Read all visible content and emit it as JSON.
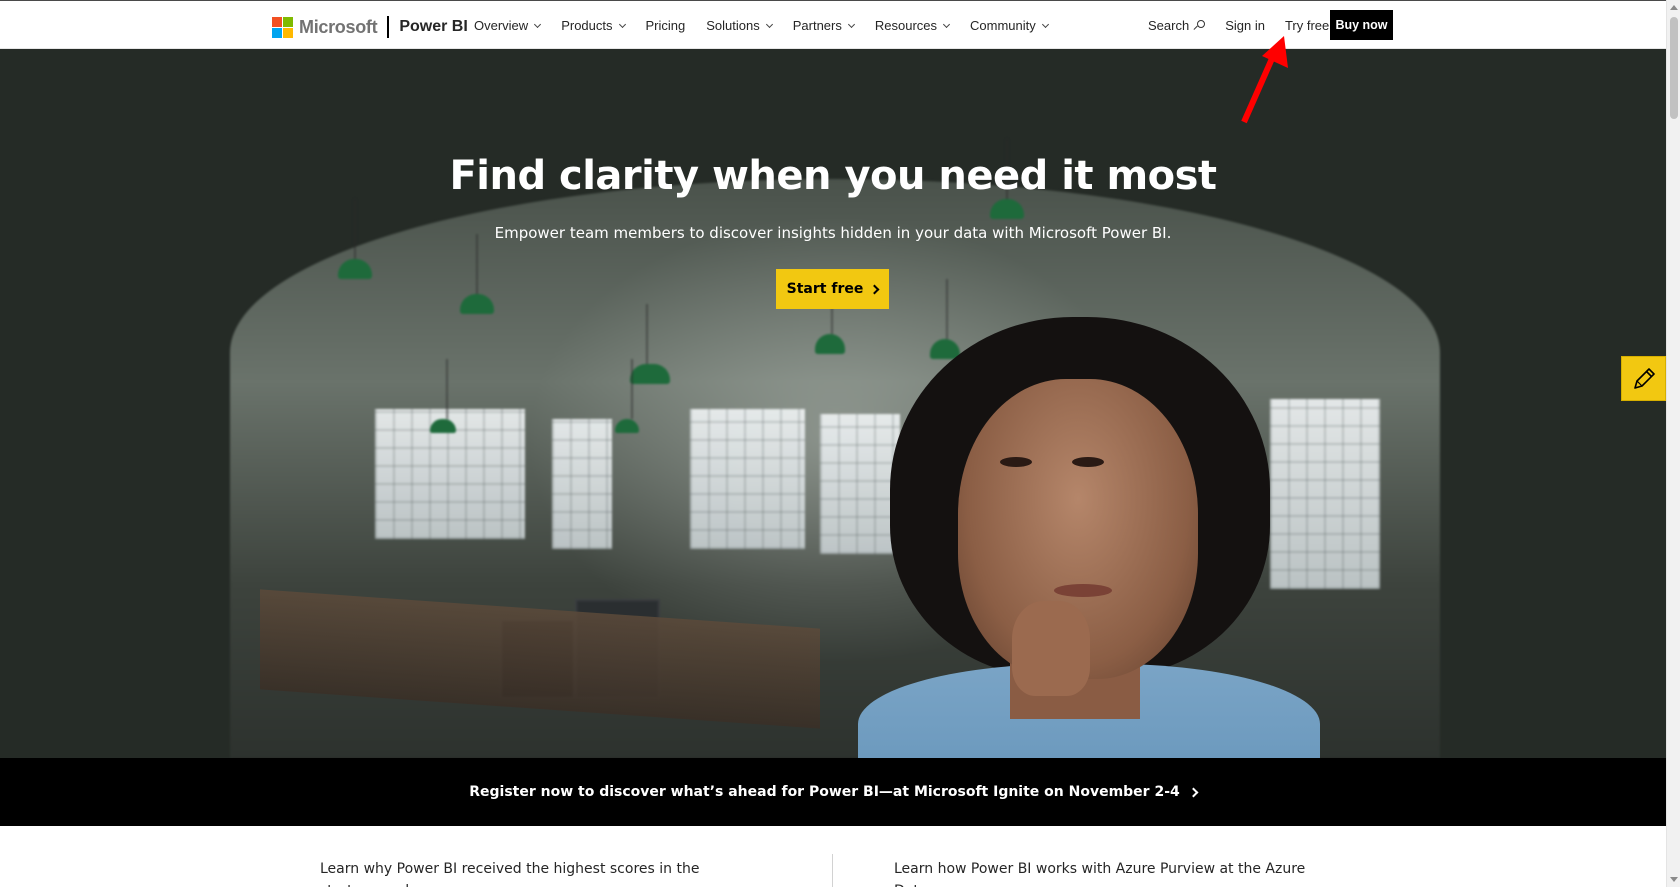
{
  "header": {
    "brand_name": "Microsoft",
    "product_name": "Power BI",
    "logo_colors": [
      "#f25022",
      "#7fba00",
      "#00a4ef",
      "#ffb900"
    ],
    "nav": [
      {
        "label": "Overview",
        "has_dropdown": true
      },
      {
        "label": "Products",
        "has_dropdown": true
      },
      {
        "label": "Pricing",
        "has_dropdown": false
      },
      {
        "label": "Solutions",
        "has_dropdown": true
      },
      {
        "label": "Partners",
        "has_dropdown": true
      },
      {
        "label": "Resources",
        "has_dropdown": true
      },
      {
        "label": "Community",
        "has_dropdown": true
      }
    ],
    "search_label": "Search",
    "search_icon": "search-icon",
    "sign_in_label": "Sign in",
    "try_free_label": "Try free",
    "buy_now_label": "Buy now"
  },
  "hero": {
    "title": "Find clarity when you need it most",
    "subtitle": "Empower team members to discover insights hidden in your data with Microsoft Power BI.",
    "cta_label": "Start free",
    "cta_color": "#f2c811",
    "cta_icon": "chevron-right-icon"
  },
  "feedback": {
    "icon": "pencil-icon",
    "color": "#f2c811"
  },
  "banner": {
    "text": "Register now to discover what’s ahead for Power BI—at Microsoft Ignite on November 2-4",
    "icon": "chevron-right-icon"
  },
  "promos": [
    {
      "text": "Learn why Power BI received the highest scores in the strategy and"
    },
    {
      "text": "Learn how Power BI works with Azure Purview at the Azure Data"
    }
  ],
  "annotation": {
    "icon": "red-arrow-icon",
    "color": "#ff0000"
  }
}
